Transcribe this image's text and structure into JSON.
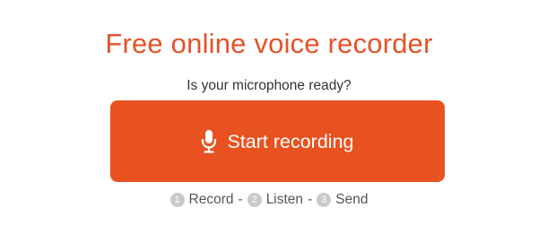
{
  "header": {
    "title": "Free online voice recorder"
  },
  "main": {
    "question": "Is your microphone ready?",
    "record_button": {
      "label": "Start recording",
      "icon": "microphone-icon",
      "color": "#e85220"
    },
    "steps": [
      {
        "number": "1",
        "label": "Record"
      },
      {
        "number": "2",
        "label": "Listen"
      },
      {
        "number": "3",
        "label": "Send"
      }
    ],
    "separator": "-"
  },
  "colors": {
    "accent": "#e3532a",
    "button": "#e85220",
    "step_badge": "#c9c9c9"
  }
}
